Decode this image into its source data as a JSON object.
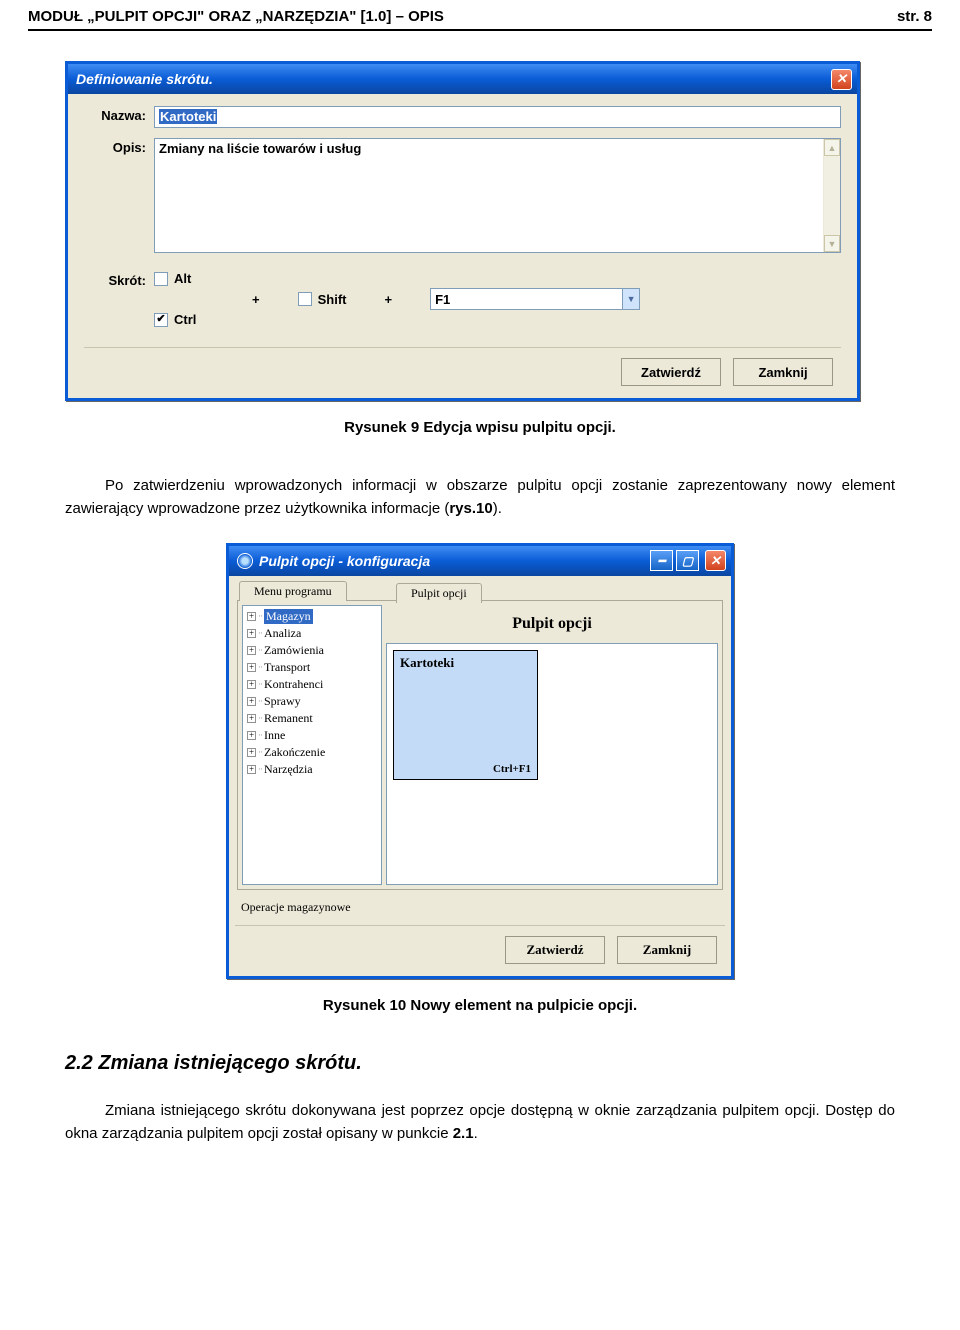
{
  "header": {
    "title_left": "MODUŁ „PULPIT OPCJI\" ORAZ „NARZĘDZIA\" [1.0] – OPIS",
    "title_right": "str. 8"
  },
  "win1": {
    "title": "Definiowanie skrótu.",
    "label_name": "Nazwa:",
    "value_name": "Kartoteki",
    "label_desc": "Opis:",
    "value_desc": "Zmiany na liście towarów i usług",
    "label_shortcut": "Skrót:",
    "chk_alt": "Alt",
    "chk_shift": "Shift",
    "chk_ctrl": "Ctrl",
    "combo_key": "F1",
    "plus": "+",
    "btn_ok": "Zatwierdź",
    "btn_close": "Zamknij"
  },
  "caption1": "Rysunek 9 Edycja wpisu pulpitu opcji.",
  "para1": "Po zatwierdzeniu wprowadzonych informacji w obszarze pulpitu opcji zostanie zaprezentowany nowy element zawierający wprowadzone przez użytkownika informacje (",
  "para1_ref": "rys.10",
  "para1_end": ").",
  "win2": {
    "title": "Pulpit opcji - konfiguracja",
    "tab1": "Menu programu",
    "tab2": "Pulpit opcji",
    "panel_title": "Pulpit opcji",
    "tree": [
      "Magazyn",
      "Analiza",
      "Zamówienia",
      "Transport",
      "Kontrahenci",
      "Sprawy",
      "Remanent",
      "Inne",
      "Zakończenie",
      "Narzędzia"
    ],
    "tile_name": "Kartoteki",
    "tile_shortcut": "Ctrl+F1",
    "lower_label": "Operacje magazynowe",
    "btn_ok": "Zatwierdź",
    "btn_close": "Zamknij"
  },
  "caption2": "Rysunek 10 Nowy element na pulpicie opcji.",
  "section_heading": "2.2 Zmiana istniejącego skrótu.",
  "para2a": "Zmiana istniejącego skrótu dokonywana jest poprzez opcje dostępną w oknie zarządzania pulpitem opcji. Dostęp do okna zarządzania pulpitem opcji został opisany w punkcie ",
  "para2_ref": "2.1",
  "para2_end": "."
}
